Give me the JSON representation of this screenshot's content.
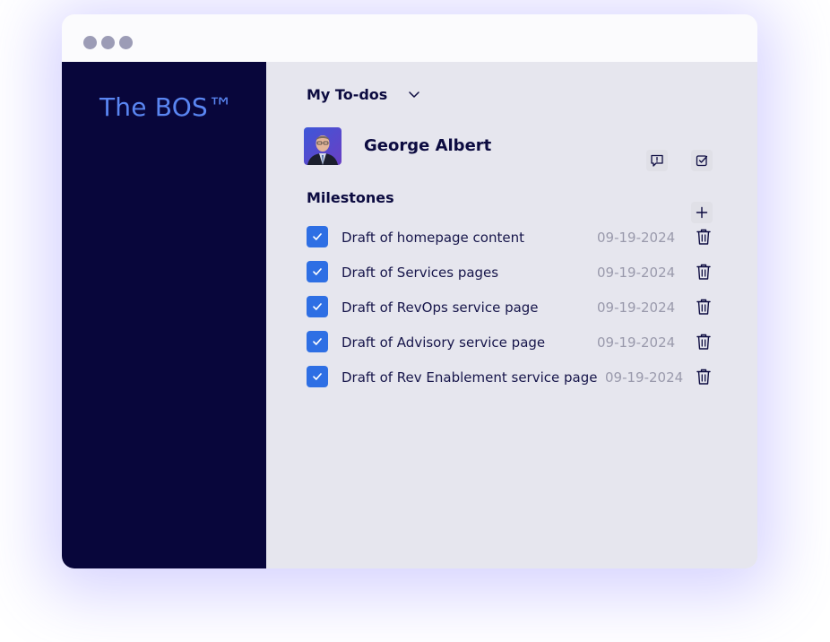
{
  "sidebar": {
    "brand": "The BOS™"
  },
  "header": {
    "title": "My To-dos"
  },
  "user": {
    "name": "George Albert"
  },
  "milestones": {
    "title": "Milestones",
    "items": [
      {
        "label": "Draft of homepage content",
        "date": "09-19-2024",
        "checked": true
      },
      {
        "label": "Draft of Services pages",
        "date": "09-19-2024",
        "checked": true
      },
      {
        "label": "Draft of RevOps service page",
        "date": "09-19-2024",
        "checked": true
      },
      {
        "label": "Draft of Advisory service page",
        "date": "09-19-2024",
        "checked": true
      },
      {
        "label": "Draft of Rev Enablement service page",
        "date": "09-19-2024",
        "checked": true
      }
    ]
  },
  "colors": {
    "sidebar": "#08063b",
    "brand": "#5a86f2",
    "accent": "#2e6fe4",
    "main_bg": "#e6e6ee"
  },
  "icons": {
    "dropdown": "chevron-down-icon",
    "feedback": "message-alert-icon",
    "tasks": "checkbox-icon",
    "add": "plus-icon",
    "delete": "trash-icon"
  }
}
